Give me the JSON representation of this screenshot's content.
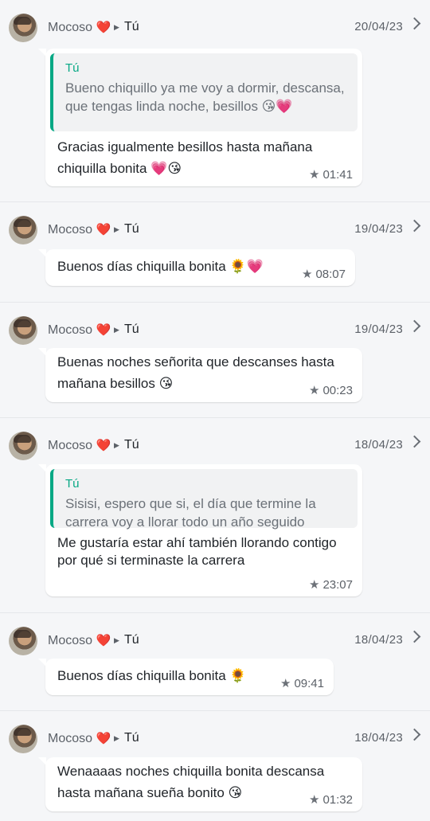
{
  "messages": [
    {
      "sender": "Mocoso",
      "sender_emoji": "❤️",
      "recipient": "Tú",
      "date": "20/04/23",
      "quote": {
        "author": "Tú",
        "text": "Bueno chiquillo ya me voy a dormir, descansa, que tengas linda noche, besillos 😘💗"
      },
      "text": "Gracias igualmente besillos hasta mañana chiquilla bonita 💗😘",
      "time": "01:41",
      "starred": true
    },
    {
      "sender": "Mocoso",
      "sender_emoji": "❤️",
      "recipient": "Tú",
      "date": "19/04/23",
      "text": "Buenos días chiquilla bonita 🌻💗",
      "time": "08:07",
      "starred": true
    },
    {
      "sender": "Mocoso",
      "sender_emoji": "❤️",
      "recipient": "Tú",
      "date": "19/04/23",
      "text": "Buenas noches señorita que descanses hasta mañana besillos 😘",
      "time": "00:23",
      "starred": true
    },
    {
      "sender": "Mocoso",
      "sender_emoji": "❤️",
      "recipient": "Tú",
      "date": "18/04/23",
      "quote": {
        "author": "Tú",
        "text": "Sisisi, espero que si, el día que termine la carrera voy a llorar todo un año seguido"
      },
      "text": "Me gustaría estar ahí también llorando contigo por qué si terminaste la carrera",
      "time": "23:07",
      "starred": true
    },
    {
      "sender": "Mocoso",
      "sender_emoji": "❤️",
      "recipient": "Tú",
      "date": "18/04/23",
      "text": "Buenos días chiquilla bonita 🌻",
      "time": "09:41",
      "starred": true
    },
    {
      "sender": "Mocoso",
      "sender_emoji": "❤️",
      "recipient": "Tú",
      "date": "18/04/23",
      "text": "Wenaaaas noches chiquilla bonita descansa hasta mañana sueña bonito 😘",
      "time": "01:32",
      "starred": true
    }
  ]
}
